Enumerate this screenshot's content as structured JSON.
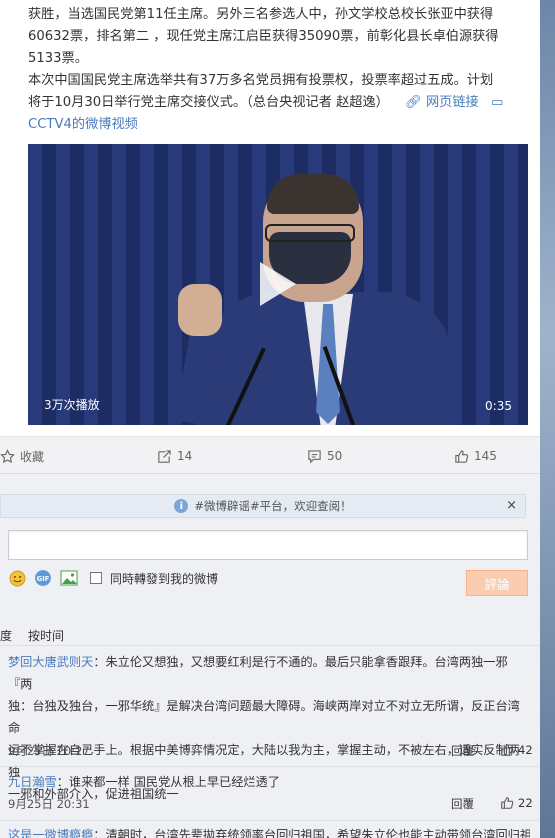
{
  "post": {
    "line1": "获胜，当选国民党第11任主席。另外三名参选人中，孙文学校总校长张亚中获得",
    "line2": "60632票，排名第二 ，现任党主席江启臣获得35090票，前彰化县长卓伯源获得",
    "line3": "5133票。",
    "line4": "本次中国国民党主席选举共有37万多名党员拥有投票权，投票率超过五成。计划",
    "line5_text": "将于10月30日举行党主席交接仪式。（总台央视记者 赵超逸）",
    "link_label": "网页链接",
    "video_link": "CCTV4的微博视频"
  },
  "video": {
    "play_count": "3万次播放",
    "duration": "0:35"
  },
  "actions": {
    "favorite": "收藏",
    "repost": "14",
    "comment": "50",
    "like": "145"
  },
  "notice": {
    "text": "#微博辟谣#平台，欢迎查阅！",
    "close": "×"
  },
  "composer": {
    "placeholder": "",
    "also_repost": "同時轉發到我的微博",
    "submit": "評論"
  },
  "sort": {
    "left": "度",
    "by_time": "按时间"
  },
  "comments": [
    {
      "user": "梦回大唐武则天",
      "text_l1": "：朱立伦又想独，又想要红利是行不通的。最后只能拿香跟拜。台湾两独一邪『两",
      "text_l2": "独：台独及独台，一邪华统』是解决台湾问题最大障碍。海峡两岸对立不对立无所谓，反正台湾命",
      "text_l3": "运不掌握在自己手上。根据中美博弈情况定，大陆以我为主，掌握主动，不被左右，适实反制两独",
      "text_l4": "一邪和外部介入，促进祖国统一",
      "time": "9月25日 20:27",
      "reply": "回覆",
      "likes": "42"
    },
    {
      "user": "九日瀚雪",
      "text_l1": "：谁来都一样 国民党从根上早已经烂透了",
      "time": "9月25日 20:31",
      "reply": "回覆",
      "likes": "22"
    },
    {
      "user": "这是一微博瘾瘾",
      "text_l1": "：清朝时，台湾先辈拋弃统领率台回归祖国，希望朱立伦也能主动带领台湾回归祖"
    }
  ],
  "colors": {
    "link": "#4a7bbd",
    "submit_bg": "#fbcdb0"
  }
}
